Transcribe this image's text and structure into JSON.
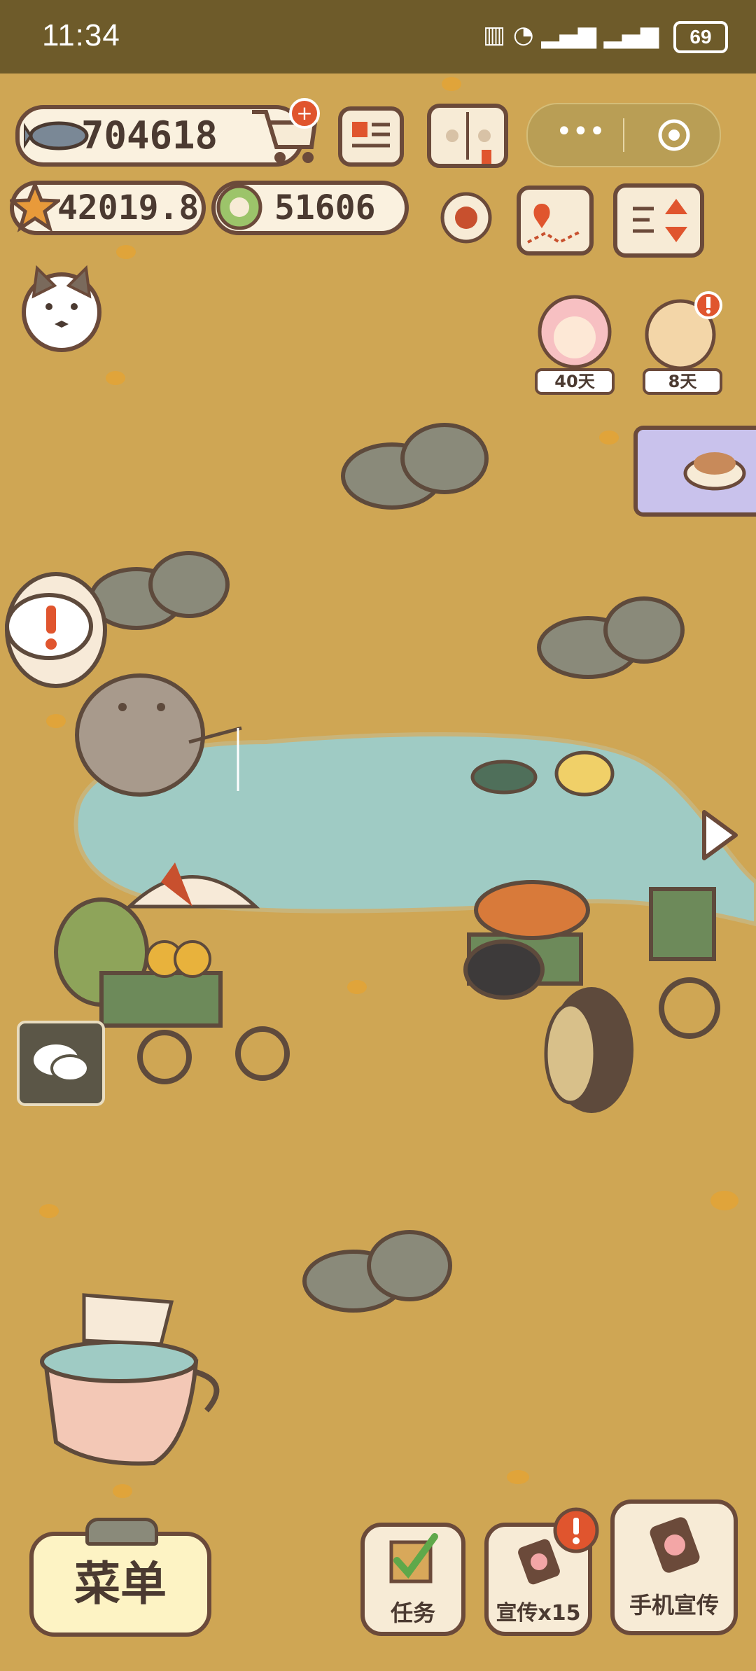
{
  "status_bar": {
    "time": "11:34",
    "battery": "69"
  },
  "currency": {
    "fish": "704618",
    "stars": "42019.8",
    "coins": "51606"
  },
  "events": [
    {
      "label": "40天"
    },
    {
      "label": "8天"
    }
  ],
  "bottom_bar": {
    "menu_label": "菜单",
    "tasks_label": "任务",
    "promote_label": "宣传x15",
    "phone_promote_label": "手机宣传"
  },
  "colors": {
    "ground": "#cfa654",
    "pond": "#9fcbc4",
    "outline": "#6b4a3a",
    "status_bar": "#6e5b2a",
    "alert": "#e0552e"
  },
  "icons": [
    "fish-icon",
    "cart-plus-icon",
    "notice-icon",
    "paw-book-icon",
    "more-icon",
    "target-icon",
    "star-icon",
    "coin-icon",
    "settings-icon",
    "map-icon",
    "sort-icon",
    "chat-icon",
    "arrow-right-icon",
    "checklist-icon",
    "phone-promo-icon"
  ]
}
